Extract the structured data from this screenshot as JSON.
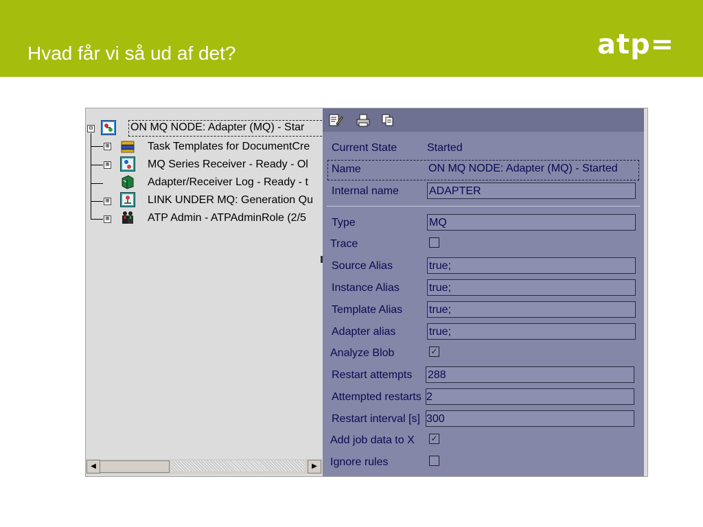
{
  "slide": {
    "title": "Hvad får vi så ud af det?",
    "logo": "atp=",
    "accent_color": "#a5bd0d"
  },
  "tree": {
    "root": {
      "label": "ON MQ NODE: Adapter (MQ) - Star",
      "icon": "adapter-icon",
      "expander": "⊟"
    },
    "children": [
      {
        "label": "Task Templates for DocumentCre",
        "icon": "templates-icon",
        "expander": "⊞"
      },
      {
        "label": "MQ Series Receiver - Ready - Ol",
        "icon": "receiver-icon",
        "expander": "⊞"
      },
      {
        "label": "Adapter/Receiver Log - Ready - t",
        "icon": "log-book-icon",
        "expander": ""
      },
      {
        "label": "LINK UNDER MQ: Generation Qu",
        "icon": "link-icon",
        "expander": "⊞"
      },
      {
        "label": "ATP Admin - ATPAdminRole (2/5",
        "icon": "admin-users-icon",
        "expander": "⊞"
      }
    ]
  },
  "toolbar": {
    "icons": [
      "edit-icon",
      "print-icon",
      "copy-icon"
    ]
  },
  "properties": {
    "current_state": {
      "label": "Current State",
      "value": "Started"
    },
    "name": {
      "label": "Name",
      "value": "ON MQ NODE: Adapter (MQ) - Started"
    },
    "internal_name": {
      "label": "Internal name",
      "value": "ADAPTER"
    },
    "type": {
      "label": "Type",
      "value": "MQ"
    },
    "trace": {
      "label": "Trace",
      "checked": false
    },
    "source_alias": {
      "label": "Source Alias",
      "value": "true;"
    },
    "instance_alias": {
      "label": "Instance Alias",
      "value": "true;"
    },
    "template_alias": {
      "label": "Template Alias",
      "value": "true;"
    },
    "adapter_alias": {
      "label": "Adapter alias",
      "value": "true;"
    },
    "analyze_blob": {
      "label": "Analyze Blob",
      "checked": true,
      "mark": "✓"
    },
    "restart_attempts": {
      "label": "Restart attempts",
      "value": "288"
    },
    "attempted_restarts": {
      "label": "Attempted restarts",
      "value": "2"
    },
    "restart_interval": {
      "label": "Restart interval [s]",
      "value": "300"
    },
    "add_job_data": {
      "label": "Add job data to X",
      "checked": true,
      "mark": "✓"
    },
    "ignore_rules": {
      "label": "Ignore rules",
      "checked": false
    }
  },
  "scrollbar": {
    "left_arrow": "◀",
    "right_arrow": "▶"
  }
}
